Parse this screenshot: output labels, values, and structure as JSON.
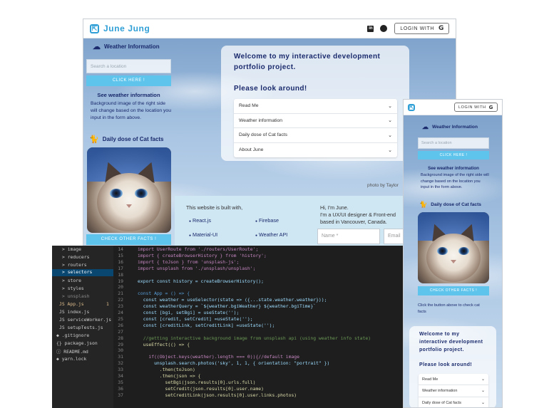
{
  "main": {
    "brand": "June Jung",
    "login_label": "LOGIN WITH",
    "g_glyph": "G",
    "sidebar": {
      "weather_title": "Weather Information",
      "location_placeholder": "Search a location",
      "click_label": "CLICK HERE !",
      "see_title": "See weather information",
      "see_body": "Background image of the right side will change based on the location you input in the form above.",
      "cat_title": "Daily dose of Cat facts",
      "check_label": "CHECK OTHER FACTS !"
    },
    "welcome": {
      "line1": "Welcome to my interactive development",
      "line2": "portfolio project.",
      "look": "Please look around!"
    },
    "accordion": [
      {
        "label": "Read Me"
      },
      {
        "label": "Weather information"
      },
      {
        "label": "Daily dose of Cat facts"
      },
      {
        "label": "About June"
      }
    ],
    "photo_by": "photo by Taylor",
    "footer": {
      "built_title": "This website is built with,",
      "tech": [
        "React.js",
        "Firebase",
        "Material-UI",
        "Weather API"
      ],
      "bullet": "●",
      "hi": "Hi, I'm June.",
      "intro1": "I'm a UX/UI designer & Front-end",
      "intro2": "based in Vancouver, Canada.",
      "name_placeholder": "Name *",
      "email_placeholder": "Email"
    }
  },
  "mobile": {
    "login_label": "LOGIN WITH",
    "g_glyph": "G",
    "weather_title": "Weather Information",
    "location_placeholder": "Search a location",
    "click_label": "CLICK HERE !",
    "see_title": "See weather information",
    "see_body": "Background image of the right side will change based on the location you input in the form above.",
    "cat_title": "Daily dose of Cat facts",
    "check_label": "CHECK OTHER FACTS !",
    "cat_hint": "Click the button above to check cat facts",
    "welcome_line1": "Welcome to my",
    "welcome_line2": "interactive development",
    "welcome_line3": "portfolio project.",
    "look": "Please look around!",
    "accordion": [
      "Read Me",
      "Weather information",
      "Daily dose of Cat facts"
    ]
  },
  "editor": {
    "tree": [
      {
        "label": "> image",
        "kind": "folder"
      },
      {
        "label": "> reducers",
        "kind": "folder"
      },
      {
        "label": "> routers",
        "kind": "folder"
      },
      {
        "label": "> selectors",
        "kind": "selected"
      },
      {
        "label": "> store",
        "kind": "folder"
      },
      {
        "label": "> styles",
        "kind": "folder"
      },
      {
        "label": "> unsplash",
        "kind": "dim"
      },
      {
        "label": "JS App.js",
        "kind": "js",
        "badge": "1"
      },
      {
        "label": "JS index.js",
        "kind": "file"
      },
      {
        "label": "JS serviceWorker.js",
        "kind": "file"
      },
      {
        "label": "JS setupTests.js",
        "kind": "file"
      },
      {
        "label": "◆ .gitignore",
        "kind": "file"
      },
      {
        "label": "{} package.json",
        "kind": "file"
      },
      {
        "label": "ⓘ README.md",
        "kind": "file"
      },
      {
        "label": "◆ yarn.lock",
        "kind": "file"
      }
    ],
    "line_numbers": [
      "14",
      "15",
      "16",
      "17",
      "18",
      "19",
      "20",
      "21",
      "22",
      "23",
      "24",
      "25",
      "26",
      "27",
      "28",
      "29",
      "30",
      "31",
      "32",
      "33",
      "34",
      "35",
      "36",
      "37"
    ],
    "code": [
      "import UserRoute from './routers/UserRoute';",
      "import { createBrowserHistory } from 'history';",
      "import { toJson } from 'unsplash-js';",
      "import unsplash from './unsplash/unsplash';",
      "",
      "export const history = createBrowserHistory();",
      "",
      "const App = () => {",
      "  const weather = useSelector(state => ({...state.weather.weather}));",
      "  const weatherQuery = `${weather.bgiWeather} ${weather.bgiTime}`",
      "  const [bgi, setBgi] = useState('');",
      "  const [credit, setCredit] =useState('');",
      "  const [creditLink, setCreditLink] =useState('');",
      "",
      "  //getting interactive background image from unsplash api (using weather info state)",
      "  useEffect(() => {",
      "",
      "    if((Object.keys(weather).length === 0)){//default image",
      "      unsplash.search.photos('sky', 1, 1, { orientation: \"portrait\" })",
      "        .then(toJson)",
      "        .then(json => {",
      "          setBgi(json.results[0].urls.full)",
      "          setCredit(json.results[0].user.name)",
      "          setCreditLink(json.results[0].user.links.photos)"
    ]
  }
}
